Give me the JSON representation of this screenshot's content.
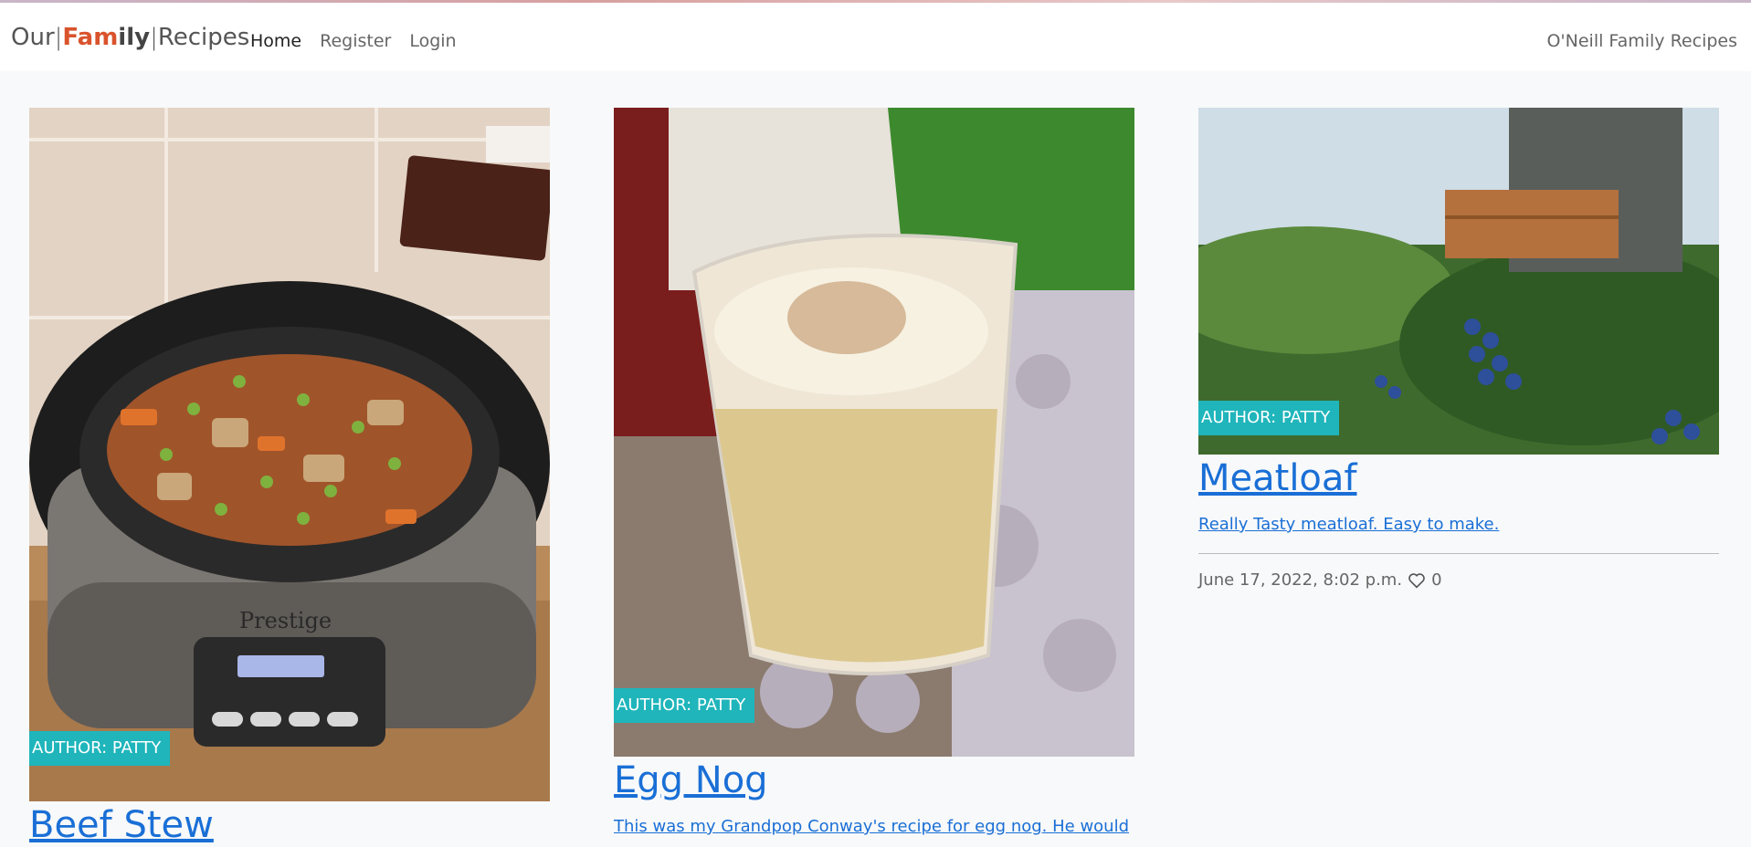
{
  "brand": {
    "our": "Our",
    "fam": "Fam",
    "ily": "ily",
    "recipes": "Recipes"
  },
  "nav": {
    "home": "Home",
    "register": "Register",
    "login": "Login",
    "site_title": "O'Neill Family Recipes"
  },
  "colors": {
    "accent": "#1fb5bb",
    "link": "#1a6fd6",
    "brand_accent": "#d9532c"
  },
  "recipes": [
    {
      "author": "AUTHOR: PATTY",
      "title": "Beef Stew",
      "image": "slow-cooker-beef-stew-photo"
    },
    {
      "author": "AUTHOR: PATTY",
      "title": "Egg Nog",
      "description": "This was my Grandpop Conway's recipe for egg nog. He would",
      "image": "egg-nog-glass-photo"
    },
    {
      "author": "AUTHOR: PATTY",
      "title": "Meatloaf",
      "description": "Really Tasty meatloaf. Easy to make.",
      "date": "June 17, 2022, 8:02 p.m.",
      "likes": "0",
      "image": "blueberry-bush-photo"
    }
  ]
}
